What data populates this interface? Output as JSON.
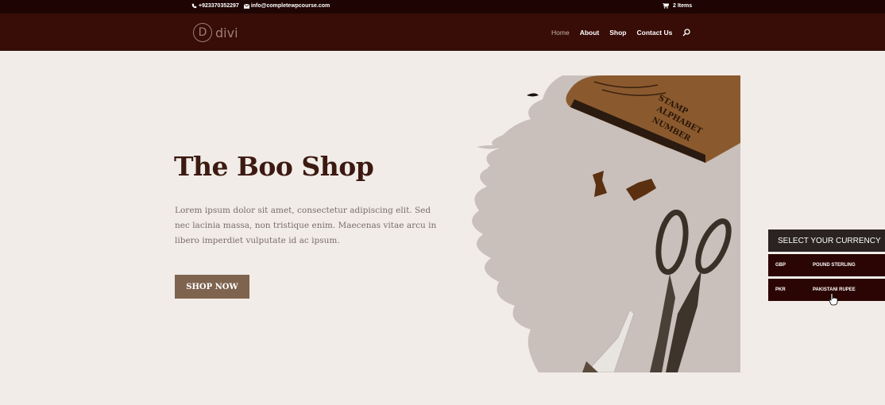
{
  "topbar": {
    "phone": "+923370352297",
    "email": "info@completewpcourse.com",
    "cart": "2 Items"
  },
  "header": {
    "logo_mark": "D",
    "logo_text": "divi",
    "nav": [
      "Home",
      "About",
      "Shop",
      "Contact Us"
    ]
  },
  "hero": {
    "title": "The Boo Shop",
    "text": "Lorem ipsum dolor sit amet, consectetur adipiscing elit. Sed nec lacinia massa, non tristique enim. Maecenas vitae arcu in libero imperdiet vulputate id ac ipsum.",
    "button": "SHOP NOW",
    "stamp_lines": [
      "STAMP",
      "ALPHABET",
      "NUMBER"
    ]
  },
  "currency": {
    "title": "SELECT YOUR CURRENCY",
    "options": [
      {
        "code": "GBP",
        "name": "POUND STERLING"
      },
      {
        "code": "PKR",
        "name": "PAKISTANI RUPEE"
      }
    ]
  },
  "colors": {
    "topbar": "#1e0503",
    "header": "#380c07",
    "background": "#f1ece8",
    "title": "#3c1a11",
    "button": "#7e634f",
    "currency_row": "#2b0503"
  }
}
